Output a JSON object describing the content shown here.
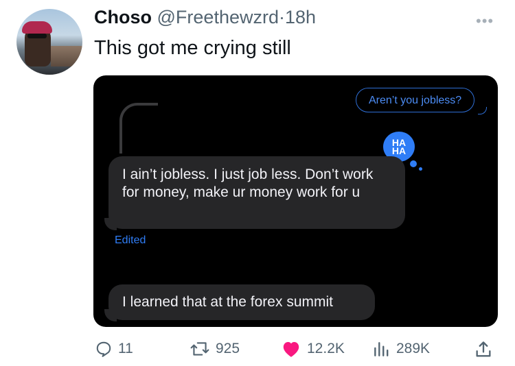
{
  "author": {
    "name": "Choso",
    "handle": "@Freethewzrd",
    "separator": "·",
    "time": "18h"
  },
  "tweet": {
    "text": "This got me crying still"
  },
  "more_label": "•••",
  "media": {
    "outgoing_message": "Aren’t you jobless?",
    "tapback": {
      "line1": "HA",
      "line2": "HA"
    },
    "reply_message": "I ain’t jobless. I just job less. Don’t work for money, make ur money work for u",
    "edited_label": "Edited",
    "followup_message": "I learned that at the forex summit"
  },
  "actions": {
    "replies": "11",
    "retweets": "925",
    "likes": "12.2K",
    "views": "289K"
  },
  "colors": {
    "like": "#f91880",
    "link": "#2f7df6",
    "muted": "#536471"
  }
}
